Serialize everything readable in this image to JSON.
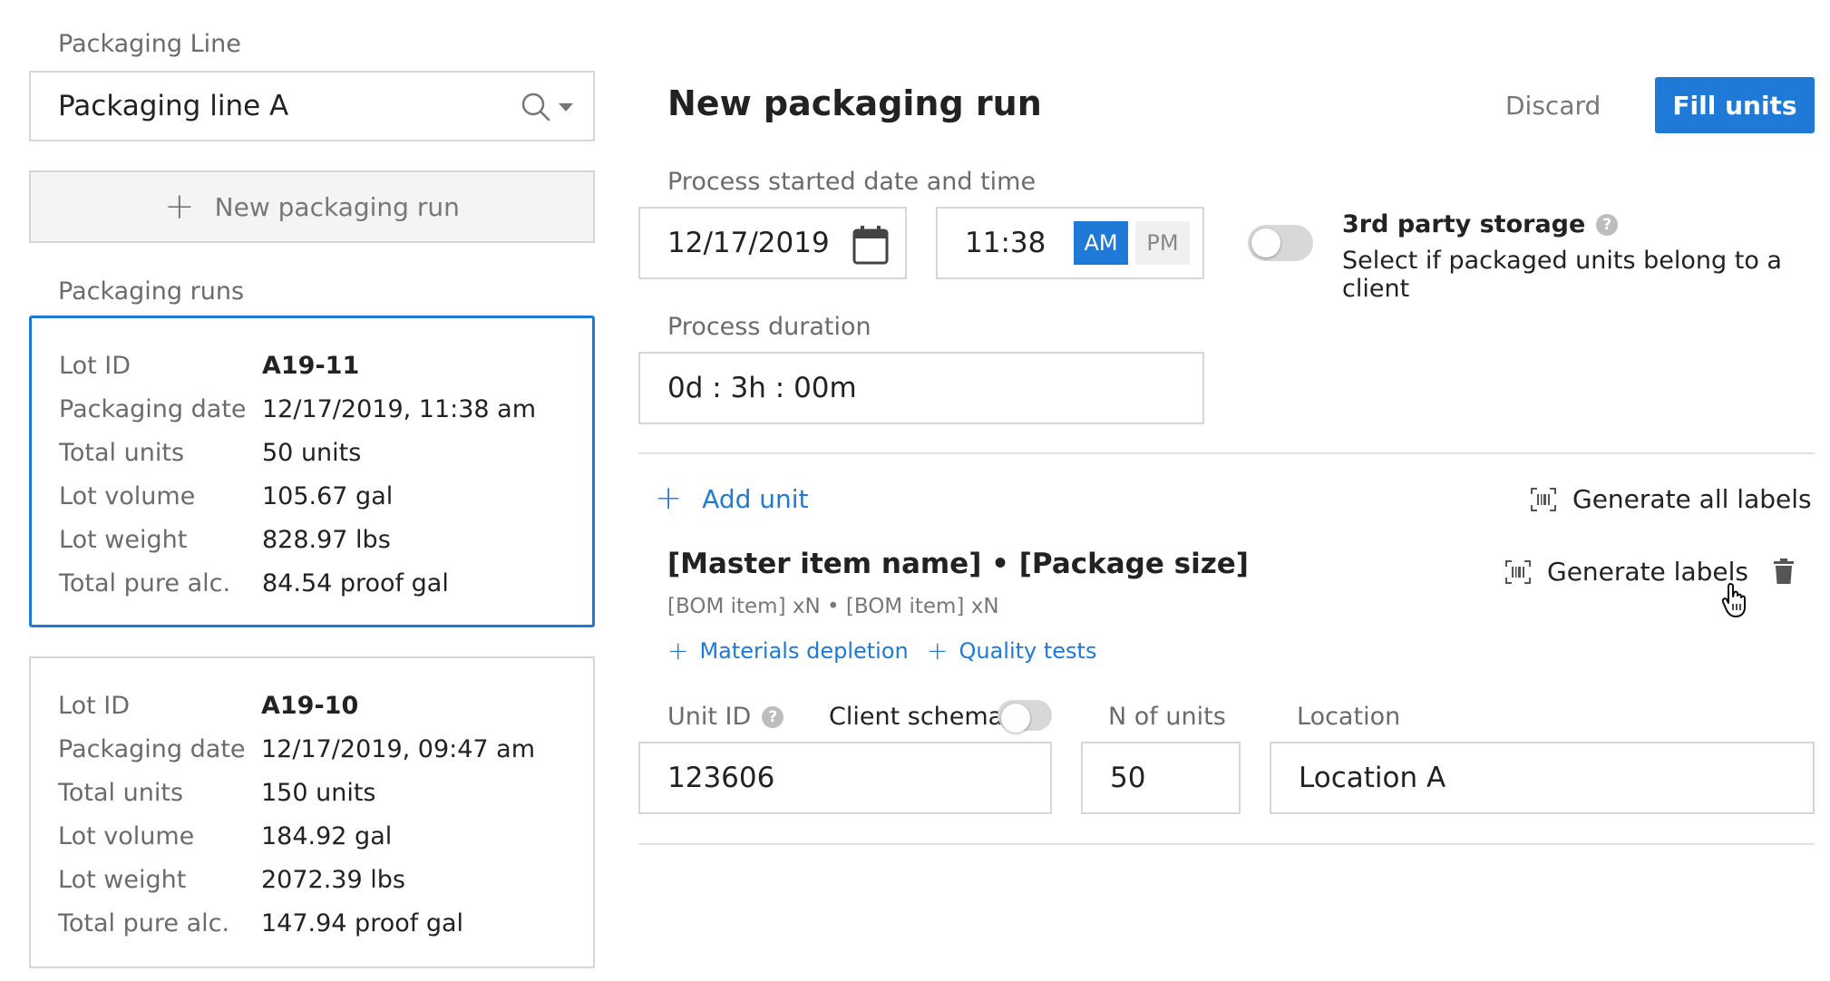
{
  "sidebar": {
    "line_label": "Packaging Line",
    "line_value": "Packaging line A",
    "new_run_label": "New packaging run",
    "runs_label": "Packaging runs",
    "runs": [
      {
        "rows": [
          {
            "key": "Lot ID",
            "value": "A19-11"
          },
          {
            "key": "Packaging date",
            "value": "12/17/2019, 11:38 am"
          },
          {
            "key": "Total units",
            "value": "50 units"
          },
          {
            "key": "Lot volume",
            "value": "105.67 gal"
          },
          {
            "key": "Lot weight",
            "value": "828.97 lbs"
          },
          {
            "key": "Total pure alc.",
            "value": "84.54 proof gal"
          }
        ]
      },
      {
        "rows": [
          {
            "key": "Lot ID",
            "value": "A19-10"
          },
          {
            "key": "Packaging date",
            "value": "12/17/2019, 09:47 am"
          },
          {
            "key": "Total units",
            "value": "150 units"
          },
          {
            "key": "Lot volume",
            "value": "184.92 gal"
          },
          {
            "key": "Lot weight",
            "value": "2072.39 lbs"
          },
          {
            "key": "Total pure alc.",
            "value": "147.94 proof gal"
          }
        ]
      }
    ]
  },
  "form": {
    "title": "New packaging run",
    "discard_label": "Discard",
    "fill_units_label": "Fill units",
    "started_label": "Process started date and time",
    "date_value": "12/17/2019",
    "time_value": "11:38",
    "am_label": "AM",
    "pm_label": "PM",
    "storage_title": "3rd party storage",
    "storage_desc": "Select if packaged units belong to a client",
    "duration_label": "Process duration",
    "duration_value": "0d : 3h : 00m",
    "add_unit_label": "Add unit",
    "generate_all_label": "Generate all labels"
  },
  "unit": {
    "title": "[Master item name] • [Package size]",
    "subtitle": "[BOM item] xN • [BOM item] xN",
    "generate_label": "Generate labels",
    "materials_label": "Materials depletion",
    "quality_label": "Quality tests",
    "unit_id_label": "Unit ID",
    "client_schema_label": "Client schema",
    "n_units_label": "N of units",
    "location_label": "Location",
    "unit_id_value": "123606",
    "n_units_value": "50",
    "location_value": "Location A"
  },
  "colors": {
    "accent": "#1e7ad6",
    "border": "#d6d6d6",
    "muted_text": "#6b6b6b"
  },
  "icons": [
    "search-icon",
    "chevron-down-icon",
    "plus-icon",
    "calendar-icon",
    "help-icon",
    "barcode-icon",
    "trash-icon",
    "hand-cursor-icon"
  ]
}
